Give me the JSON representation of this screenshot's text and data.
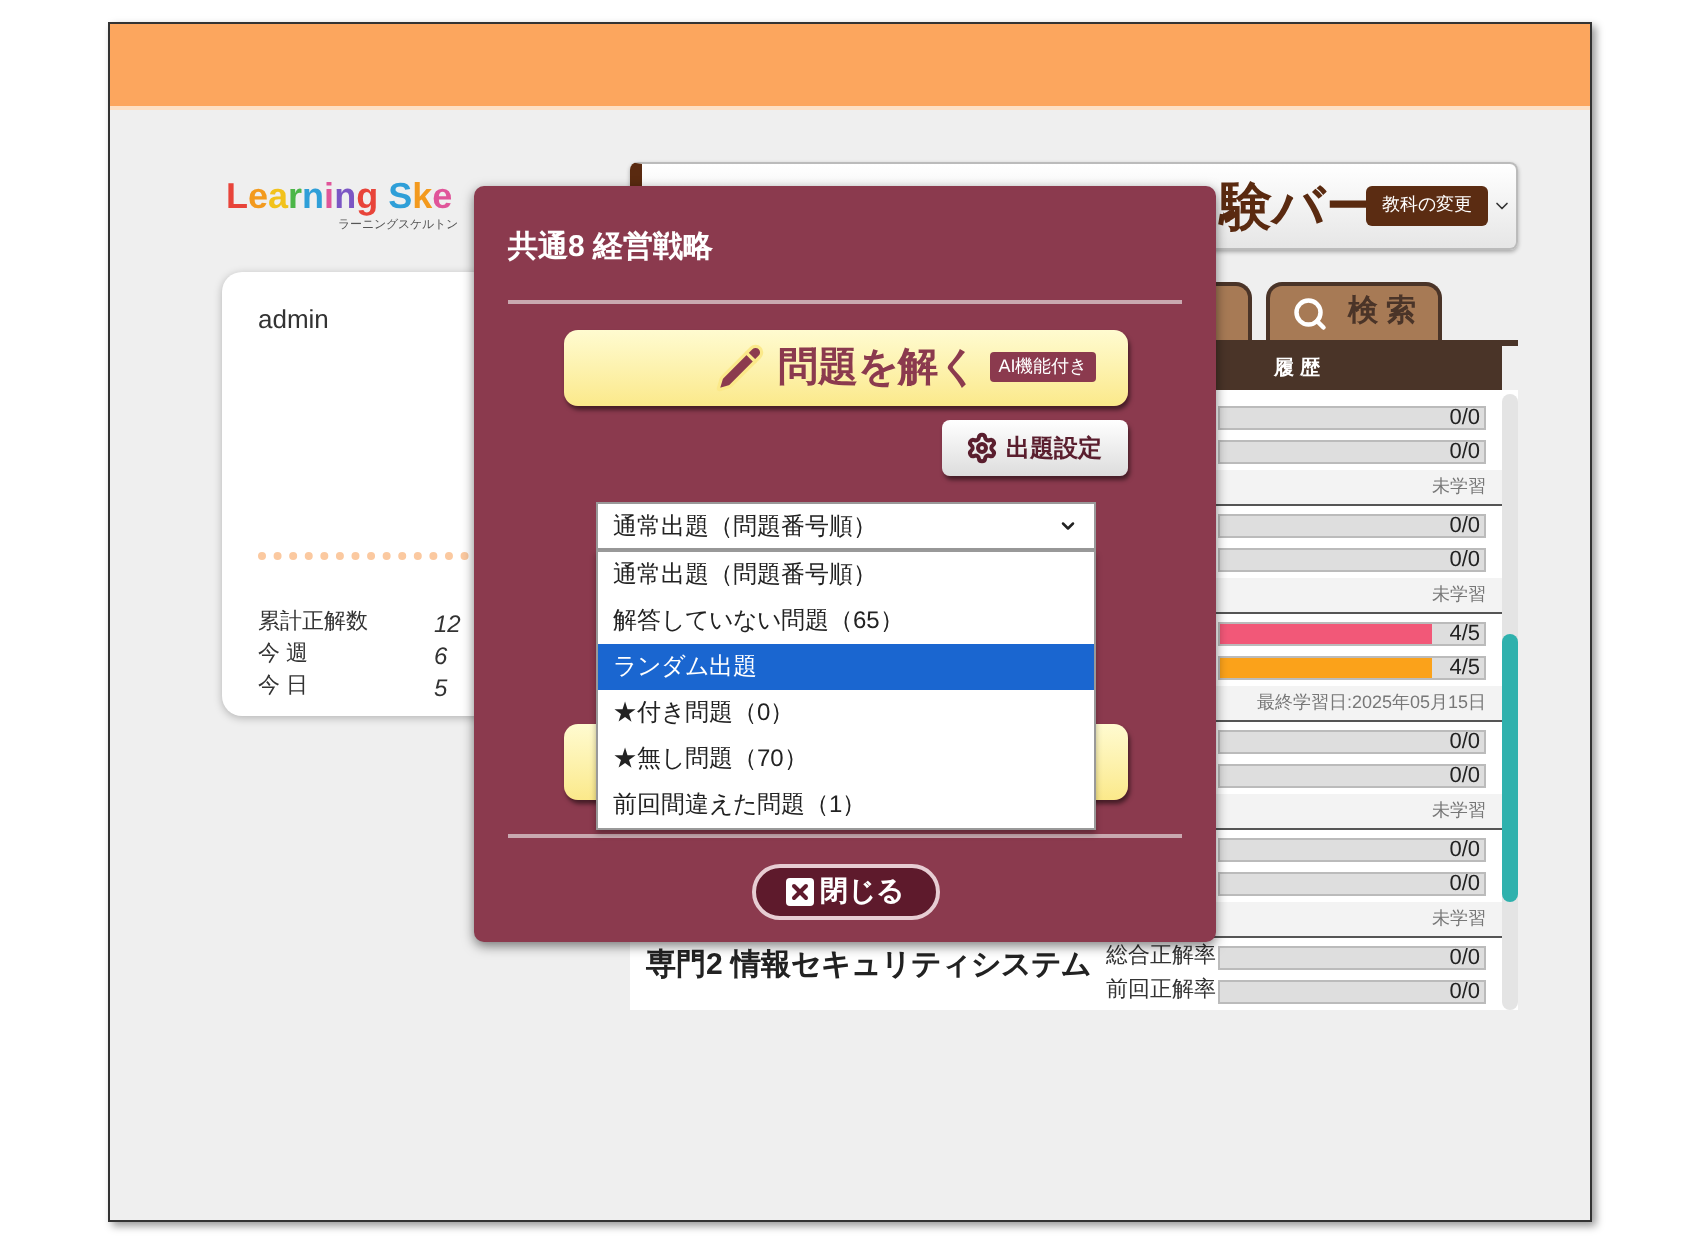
{
  "background": {
    "logo": {
      "text": "Learning Ske",
      "subtitle": "ラーニングスケルトン"
    },
    "user_card": {
      "name": "admin",
      "stats": [
        {
          "label": "累計正解数",
          "value": "12"
        },
        {
          "label": "今 週",
          "value": "6"
        },
        {
          "label": "今 日",
          "value": "5"
        }
      ]
    },
    "exam_bar": {
      "title": "験バー",
      "badge": "教科の変更"
    },
    "tabs": [
      {
        "label": "検 索"
      }
    ],
    "table": {
      "header": "履 歴",
      "groups": [
        {
          "bars": [
            {
              "level": 0,
              "reading": "0/0"
            },
            {
              "level": 0,
              "reading": "0/0"
            }
          ],
          "status": "未学習"
        },
        {
          "bars": [
            {
              "level": 0,
              "reading": "0/0"
            },
            {
              "level": 0,
              "reading": "0/0"
            }
          ],
          "status": "未学習"
        },
        {
          "bars": [
            {
              "level": 0.8,
              "reading": "4/5",
              "color": "#f25878"
            },
            {
              "level": 0.8,
              "reading": "4/5",
              "color": "#fba21a"
            }
          ],
          "status": "最終学習日:2025年05月15日"
        },
        {
          "bars": [
            {
              "level": 0,
              "reading": "0/0"
            },
            {
              "level": 0,
              "reading": "0/0"
            }
          ],
          "status": "未学習"
        },
        {
          "bars": [
            {
              "level": 0,
              "reading": "0/0"
            },
            {
              "level": 0,
              "reading": "0/0"
            }
          ],
          "status": "未学習"
        },
        {
          "title": "専門2 情報セキュリティシステム",
          "bars": [
            {
              "label": "総合正解率",
              "level": 0,
              "reading": "0/0"
            },
            {
              "label": "前回正解率",
              "level": 0,
              "reading": "0/0"
            }
          ]
        }
      ]
    }
  },
  "modal": {
    "title": "共通8 経営戦略",
    "solve_button": {
      "label": "問題を解く",
      "badge": "AI機能付き"
    },
    "settings_button": "出題設定",
    "select": {
      "value": "通常出題（問題番号順）",
      "expanded": true,
      "options": [
        {
          "label": "通常出題（問題番号順）",
          "highlighted": false
        },
        {
          "label": "解答していない問題（65）",
          "highlighted": false
        },
        {
          "label": "ランダム出題",
          "highlighted": true
        },
        {
          "label": "★付き問題（0）",
          "highlighted": false
        },
        {
          "label": "★無し問題（70）",
          "highlighted": false
        },
        {
          "label": "前回間違えた問題（1）",
          "highlighted": false
        }
      ]
    },
    "close_button": "閉じる"
  }
}
